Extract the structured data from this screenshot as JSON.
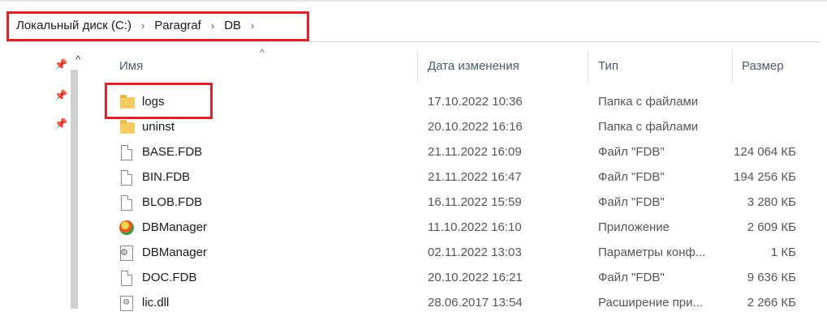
{
  "address": {
    "crumbs": [
      "Локальный диск (C:)",
      "Paragraf",
      "DB"
    ],
    "separator": "›"
  },
  "header": {
    "name": "Имя",
    "date": "Дата изменения",
    "type": "Тип",
    "size": "Размер"
  },
  "files": [
    {
      "name": "logs",
      "date": "17.10.2022 10:36",
      "type": "Папка с файлами",
      "size": "",
      "icon": "folder-icon"
    },
    {
      "name": "uninst",
      "date": "20.10.2022 16:16",
      "type": "Папка с файлами",
      "size": "",
      "icon": "folder-icon"
    },
    {
      "name": "BASE.FDB",
      "date": "21.11.2022 16:09",
      "type": "Файл \"FDB\"",
      "size": "124 064 КБ",
      "icon": "file-icon"
    },
    {
      "name": "BIN.FDB",
      "date": "21.11.2022 16:47",
      "type": "Файл \"FDB\"",
      "size": "194 256 КБ",
      "icon": "file-icon"
    },
    {
      "name": "BLOB.FDB",
      "date": "16.11.2022 15:59",
      "type": "Файл \"FDB\"",
      "size": "3 280 КБ",
      "icon": "file-icon"
    },
    {
      "name": "DBManager",
      "date": "11.10.2022 16:10",
      "type": "Приложение",
      "size": "2 609 КБ",
      "icon": "app-icon"
    },
    {
      "name": "DBManager",
      "date": "02.11.2022 13:03",
      "type": "Параметры конф...",
      "size": "1 КБ",
      "icon": "config-icon"
    },
    {
      "name": "DOC.FDB",
      "date": "20.10.2022 16:21",
      "type": "Файл \"FDB\"",
      "size": "9 636 КБ",
      "icon": "file-icon"
    },
    {
      "name": "lic.dll",
      "date": "28.06.2017 13:54",
      "type": "Расширение при...",
      "size": "2 266 КБ",
      "icon": "dll-icon"
    }
  ],
  "colors": {
    "highlight": "#d9242b",
    "folder": "#f3cd62"
  }
}
